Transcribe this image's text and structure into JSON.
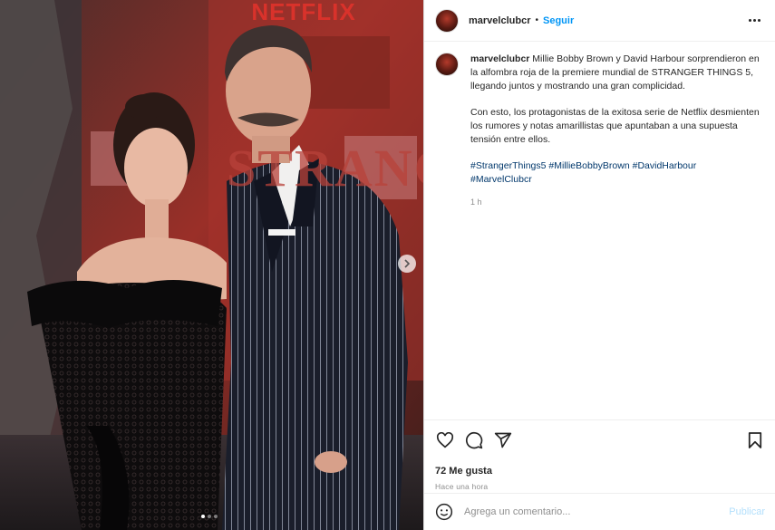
{
  "media": {
    "sign_text": "NETFLIX",
    "backdrop_text": "STRANGER",
    "carousel_dots": 3,
    "active_dot": 0
  },
  "header": {
    "username": "marvelclubcr",
    "separator": "•",
    "follow_label": "Seguir"
  },
  "caption": {
    "username": "marvelclubcr",
    "paragraph1": "Millie Bobby Brown y David Harbour sorprendieron en la alfombra roja de la premiere mundial de STRANGER THINGS 5, llegando juntos y mostrando una gran complicidad.",
    "paragraph2": "Con esto, los protagonistas de la exitosa serie de Netflix desmienten los rumores y notas amarillistas que apuntaban a una supuesta tensión entre ellos.",
    "hashtags": [
      "#StrangerThings5",
      "#MillieBobbyBrown",
      "#DavidHarbour",
      "#MarvelClubcr"
    ],
    "time": "1 h"
  },
  "actions": {
    "icons": [
      "heart-icon",
      "comment-icon",
      "share-icon",
      "bookmark-icon"
    ],
    "likes": "72 Me gusta",
    "time_ago": "Hace una hora"
  },
  "comment": {
    "placeholder": "Agrega un comentario...",
    "publish_label": "Publicar"
  },
  "colors": {
    "link_blue": "#0095f6",
    "hashtag_blue": "#00376b",
    "publish_disabled": "#b2dffc",
    "backdrop_red": "#b2342c"
  }
}
